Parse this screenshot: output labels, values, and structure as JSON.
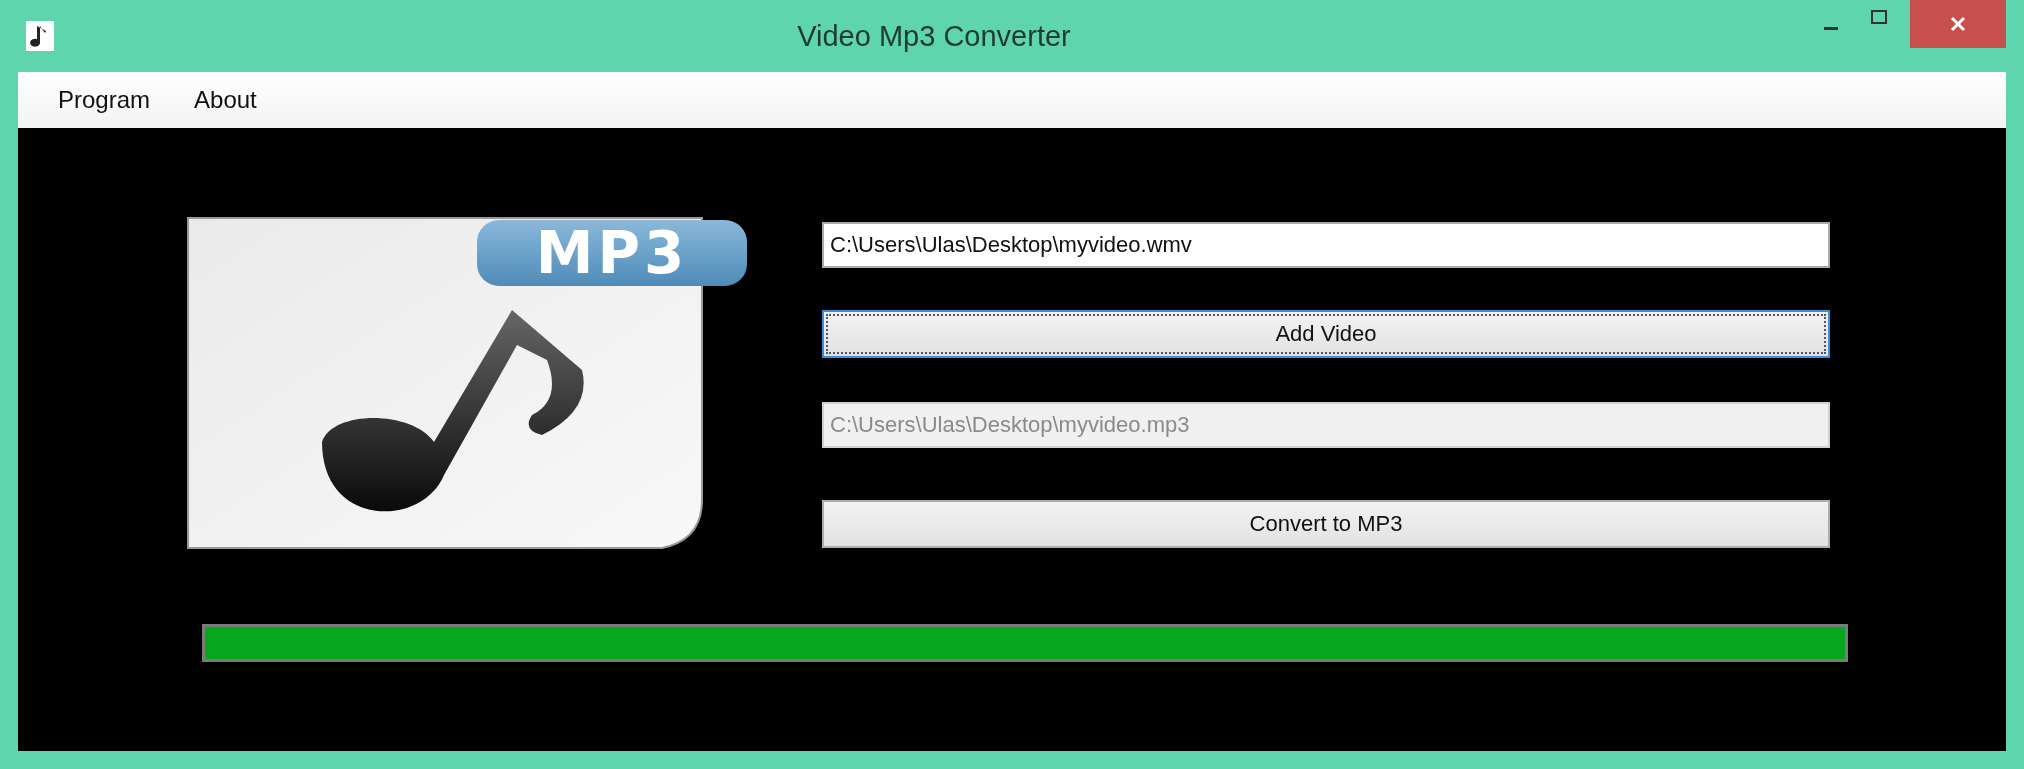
{
  "window": {
    "title": "Video Mp3 Converter"
  },
  "menu": [
    {
      "label": "Program"
    },
    {
      "label": "About"
    }
  ],
  "file_icon": {
    "badge": "MP3"
  },
  "input_path": {
    "value": "C:\\Users\\Ulas\\Desktop\\myvideo.wmv",
    "disabled": false
  },
  "add_button": {
    "label": "Add Video",
    "focused": true
  },
  "output_path": {
    "value": "C:\\Users\\Ulas\\Desktop\\myvideo.mp3",
    "disabled": true
  },
  "convert_button": {
    "label": "Convert to MP3",
    "focused": false
  },
  "progress": {
    "level": 1
  }
}
